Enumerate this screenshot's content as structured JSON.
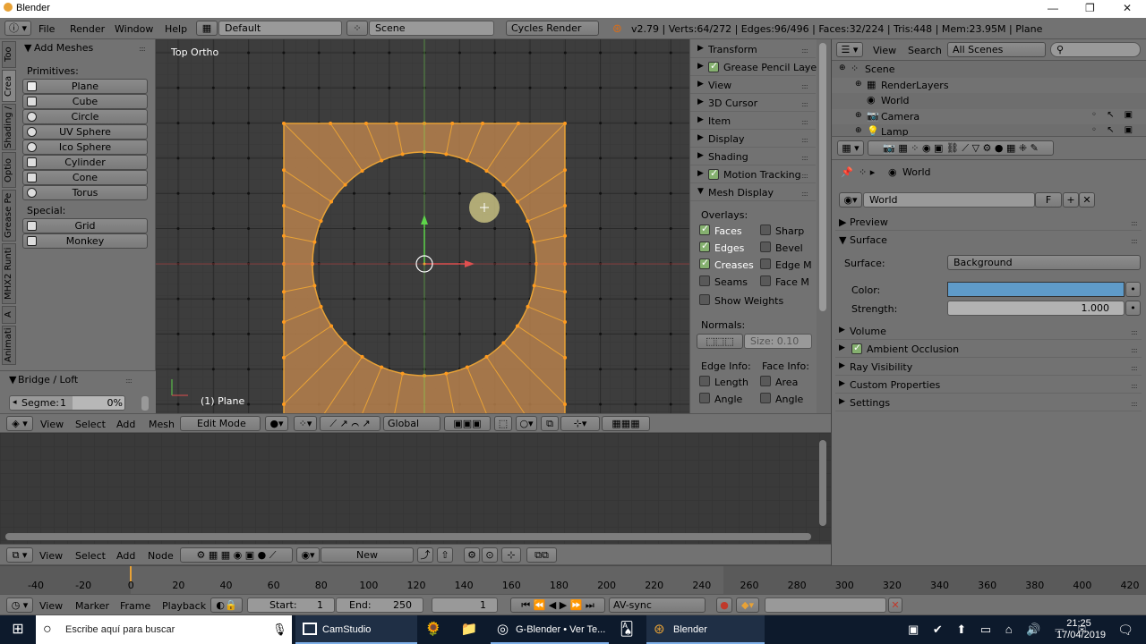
{
  "window": {
    "title": "Blender",
    "controls": [
      "—",
      "❐",
      "✕"
    ]
  },
  "info_header": {
    "menus": [
      "File",
      "Render",
      "Window",
      "Help"
    ],
    "layout": "Default",
    "scene": "Scene",
    "engine": "Cycles Render",
    "stats": "v2.79 | Verts:64/272 | Edges:96/496 | Faces:32/224 | Tris:448 | Mem:23.95M | Plane"
  },
  "tool_shelf": {
    "tabs": [
      "Too",
      "Crea",
      "Shading /",
      "Optio",
      "Grease Pe",
      "MHX2 Runti",
      "A",
      "Animati"
    ],
    "panel_title": "Add Meshes",
    "primitives_label": "Primitives:",
    "primitives": [
      "Plane",
      "Cube",
      "Circle",
      "UV Sphere",
      "Ico Sphere",
      "Cylinder",
      "Cone",
      "Torus"
    ],
    "special_label": "Special:",
    "special": [
      "Grid",
      "Monkey"
    ],
    "operator_title": "Bridge / Loft",
    "segments_label": "Segme:",
    "segments_value": "1",
    "percent": "0%"
  },
  "viewport": {
    "view_label": "Top Ortho",
    "object_label": "(1) Plane",
    "header_menus": [
      "View",
      "Select",
      "Add",
      "Mesh"
    ],
    "mode": "Edit Mode",
    "orientation": "Global"
  },
  "properties_n": {
    "sections": [
      "Transform",
      "Grease Pencil Layers",
      "View",
      "3D Cursor",
      "Item",
      "Display",
      "Shading",
      "Motion Tracking",
      "Mesh Display"
    ],
    "overlays_label": "Overlays:",
    "overlays_left": [
      {
        "label": "Faces",
        "on": true
      },
      {
        "label": "Edges",
        "on": true
      },
      {
        "label": "Creases",
        "on": true
      },
      {
        "label": "Seams",
        "on": false
      }
    ],
    "overlays_right": [
      {
        "label": "Sharp",
        "on": false
      },
      {
        "label": "Bevel",
        "on": false
      },
      {
        "label": "Edge M",
        "on": false
      },
      {
        "label": "Face M",
        "on": false
      }
    ],
    "show_weights": "Show Weights",
    "normals_label": "Normals:",
    "size_label": "Size:",
    "size_value": "0.10",
    "edge_info_label": "Edge Info:",
    "face_info_label": "Face Info:",
    "edge_info": [
      "Length",
      "Angle"
    ],
    "face_info": [
      "Area",
      "Angle"
    ]
  },
  "node_editor": {
    "header_menus": [
      "View",
      "Select",
      "Add",
      "Node"
    ],
    "new_button": "New"
  },
  "timeline": {
    "ticks": [
      "-40",
      "-20",
      "0",
      "20",
      "40",
      "60",
      "80",
      "100",
      "120",
      "140",
      "160",
      "180",
      "200",
      "220",
      "240",
      "260",
      "280",
      "300",
      "320",
      "340",
      "360",
      "380",
      "400",
      "420"
    ],
    "header_menus": [
      "View",
      "Marker",
      "Frame",
      "Playback"
    ],
    "start_label": "Start:",
    "start_value": "1",
    "end_label": "End:",
    "end_value": "250",
    "current_frame": "1",
    "sync": "AV-sync"
  },
  "outliner": {
    "view": "View",
    "search": "Search",
    "filter": "All Scenes",
    "items": [
      {
        "label": "Scene",
        "indent": 0
      },
      {
        "label": "RenderLayers",
        "indent": 1
      },
      {
        "label": "World",
        "indent": 1
      },
      {
        "label": "Camera",
        "indent": 1
      },
      {
        "label": "Lamp",
        "indent": 1
      }
    ]
  },
  "properties": {
    "breadcrumb": "World",
    "world_name": "World",
    "fake_user": "F",
    "panels": [
      "Preview",
      "Surface"
    ],
    "surface_label": "Surface:",
    "surface_value": "Background",
    "color_label": "Color:",
    "color_value": "#5f9bc9",
    "strength_label": "Strength:",
    "strength_value": "1.000",
    "more_panels": [
      {
        "label": "Volume",
        "check": false
      },
      {
        "label": "Ambient Occlusion",
        "check": true
      },
      {
        "label": "Ray Visibility",
        "check": false
      },
      {
        "label": "Custom Properties",
        "check": false
      },
      {
        "label": "Settings",
        "check": false
      }
    ]
  },
  "taskbar": {
    "search_placeholder": "Escribe aquí para buscar",
    "apps": [
      "CamStudio",
      "G-Blender • Ver Te...",
      "Blender"
    ],
    "time": "21:25",
    "date": "17/04/2019"
  },
  "colors": {
    "accent": "#e8a236",
    "blender_bg": "#727272",
    "viewport_bg": "#393939",
    "taskbar": "#0d1a2c"
  }
}
